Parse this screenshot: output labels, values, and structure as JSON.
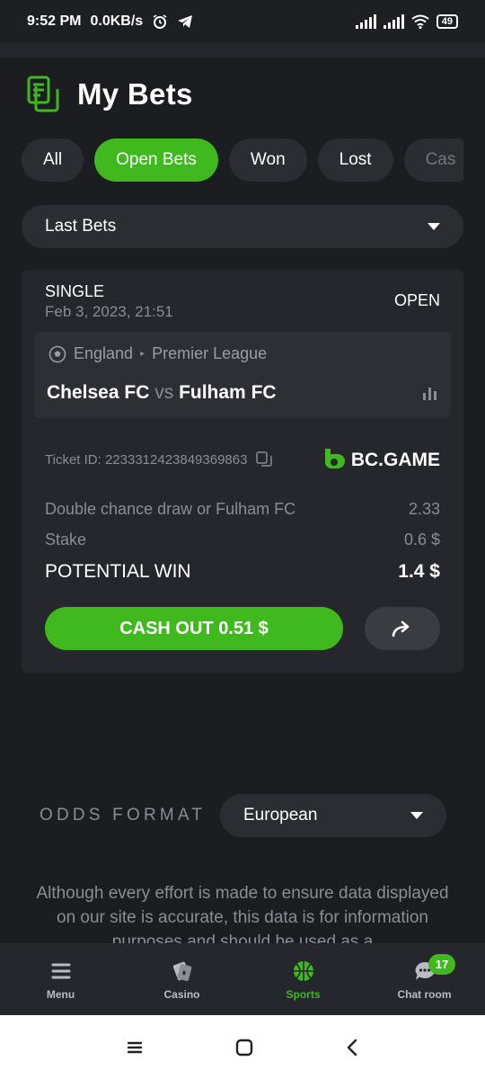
{
  "status_bar": {
    "time": "9:52 PM",
    "speed": "0.0KB/s",
    "battery": "49"
  },
  "header": {
    "title": "My Bets"
  },
  "tabs": [
    {
      "label": "All",
      "active": false
    },
    {
      "label": "Open Bets",
      "active": true
    },
    {
      "label": "Won",
      "active": false
    },
    {
      "label": "Lost",
      "active": false
    },
    {
      "label": "Cas",
      "active": false
    }
  ],
  "filter": {
    "selected": "Last Bets"
  },
  "bet": {
    "type": "SINGLE",
    "date": "Feb 3, 2023, 21:51",
    "status": "OPEN",
    "country": "England",
    "league": "Premier League",
    "home_team": "Chelsea FC",
    "vs": "vs",
    "away_team": "Fulham FC",
    "ticket_id": "Ticket ID: 2233312423849369863",
    "brand": "BC.GAME",
    "selection": "Double chance draw or Fulham FC",
    "odds": "2.33",
    "stake_label": "Stake",
    "stake_value": "0.6 $",
    "win_label": "POTENTIAL WIN",
    "win_value": "1.4 $",
    "cashout_label": "CASH OUT 0.51 $"
  },
  "odds_format": {
    "label": "ODDS FORMAT",
    "selected": "European"
  },
  "disclaimer": "Although every effort is made to ensure data displayed on our site is accurate, this data is for information purposes and should be used as a",
  "bottom_nav": [
    {
      "label": "Menu",
      "icon": "menu-icon"
    },
    {
      "label": "Casino",
      "icon": "casino-icon"
    },
    {
      "label": "Sports",
      "icon": "sports-icon",
      "active": true
    },
    {
      "label": "Chat room",
      "icon": "chat-icon",
      "badge": "17"
    }
  ],
  "colors": {
    "accent": "#3fb91d",
    "background": "#1b1d21",
    "card": "#25272c"
  }
}
